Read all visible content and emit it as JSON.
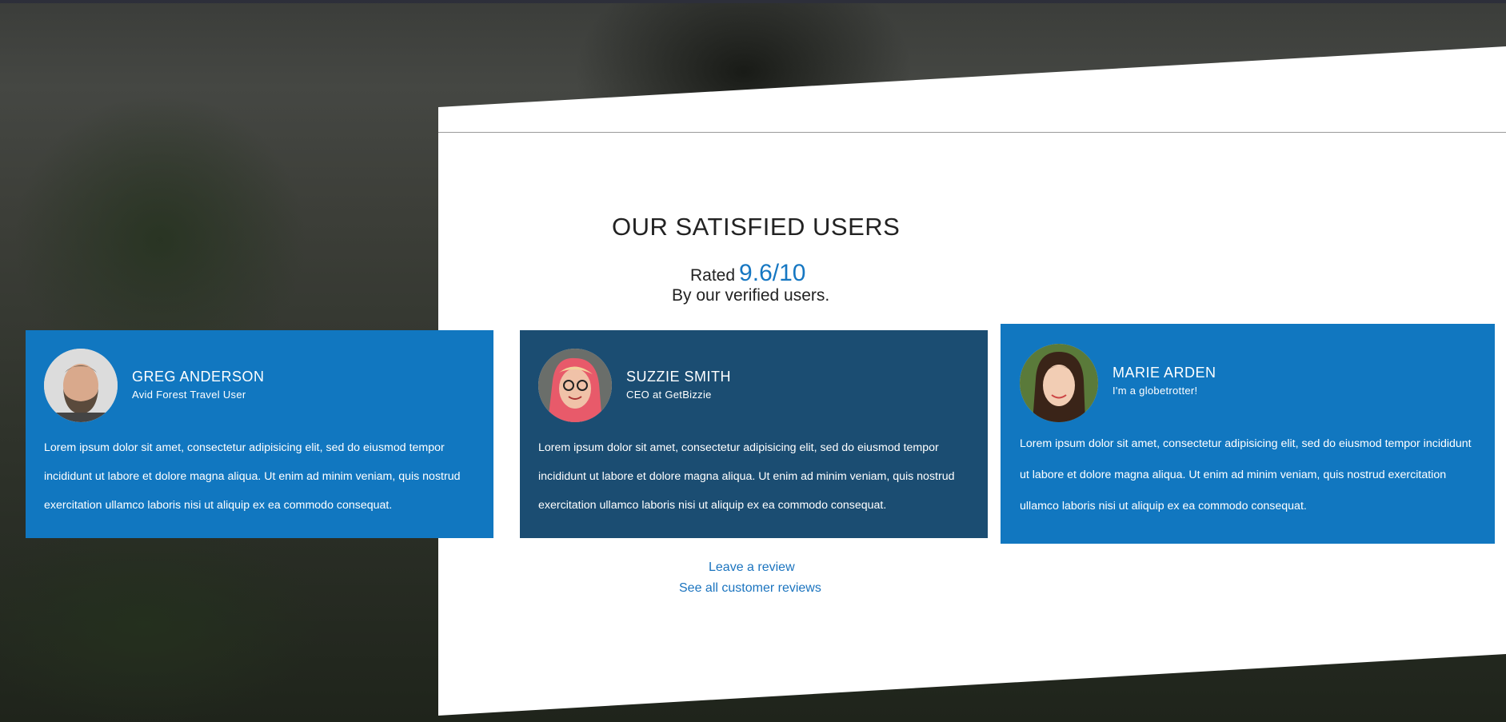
{
  "section": {
    "title": "OUR SATISFIED USERS",
    "rated_prefix": "Rated",
    "rating": "9.6/10",
    "subtitle": "By our verified users."
  },
  "testimonials": [
    {
      "name": "GREG ANDERSON",
      "role": "Avid Forest Travel User",
      "quote": "Lorem ipsum dolor sit amet, consectetur adipisicing elit, sed do eiusmod tempor incididunt ut labore et dolore magna aliqua. Ut enim ad minim veniam, quis nostrud exercitation ullamco laboris nisi ut aliquip ex ea commodo consequat.",
      "bg": "#1177c0"
    },
    {
      "name": "SUZZIE SMITH",
      "role": "CEO at GetBizzie",
      "quote": "Lorem ipsum dolor sit amet, consectetur adipisicing elit, sed do eiusmod tempor incididunt ut labore et dolore magna aliqua. Ut enim ad minim veniam, quis nostrud exercitation ullamco laboris nisi ut aliquip ex ea commodo consequat.",
      "bg": "#1b4d72"
    },
    {
      "name": "MARIE ARDEN",
      "role": "I'm a globetrotter!",
      "quote": "Lorem ipsum dolor sit amet, consectetur adipisicing elit, sed do eiusmod tempor incididunt ut labore et dolore magna aliqua. Ut enim ad minim veniam, quis nostrud exercitation ullamco laboris nisi ut aliquip ex ea commodo consequat.",
      "bg": "#1177c0"
    }
  ],
  "links": {
    "leave_review": "Leave a review",
    "see_all": "See all customer reviews"
  },
  "colors": {
    "accent": "#1677c2",
    "card_blue": "#1177c0",
    "card_dark": "#1b4d72"
  }
}
